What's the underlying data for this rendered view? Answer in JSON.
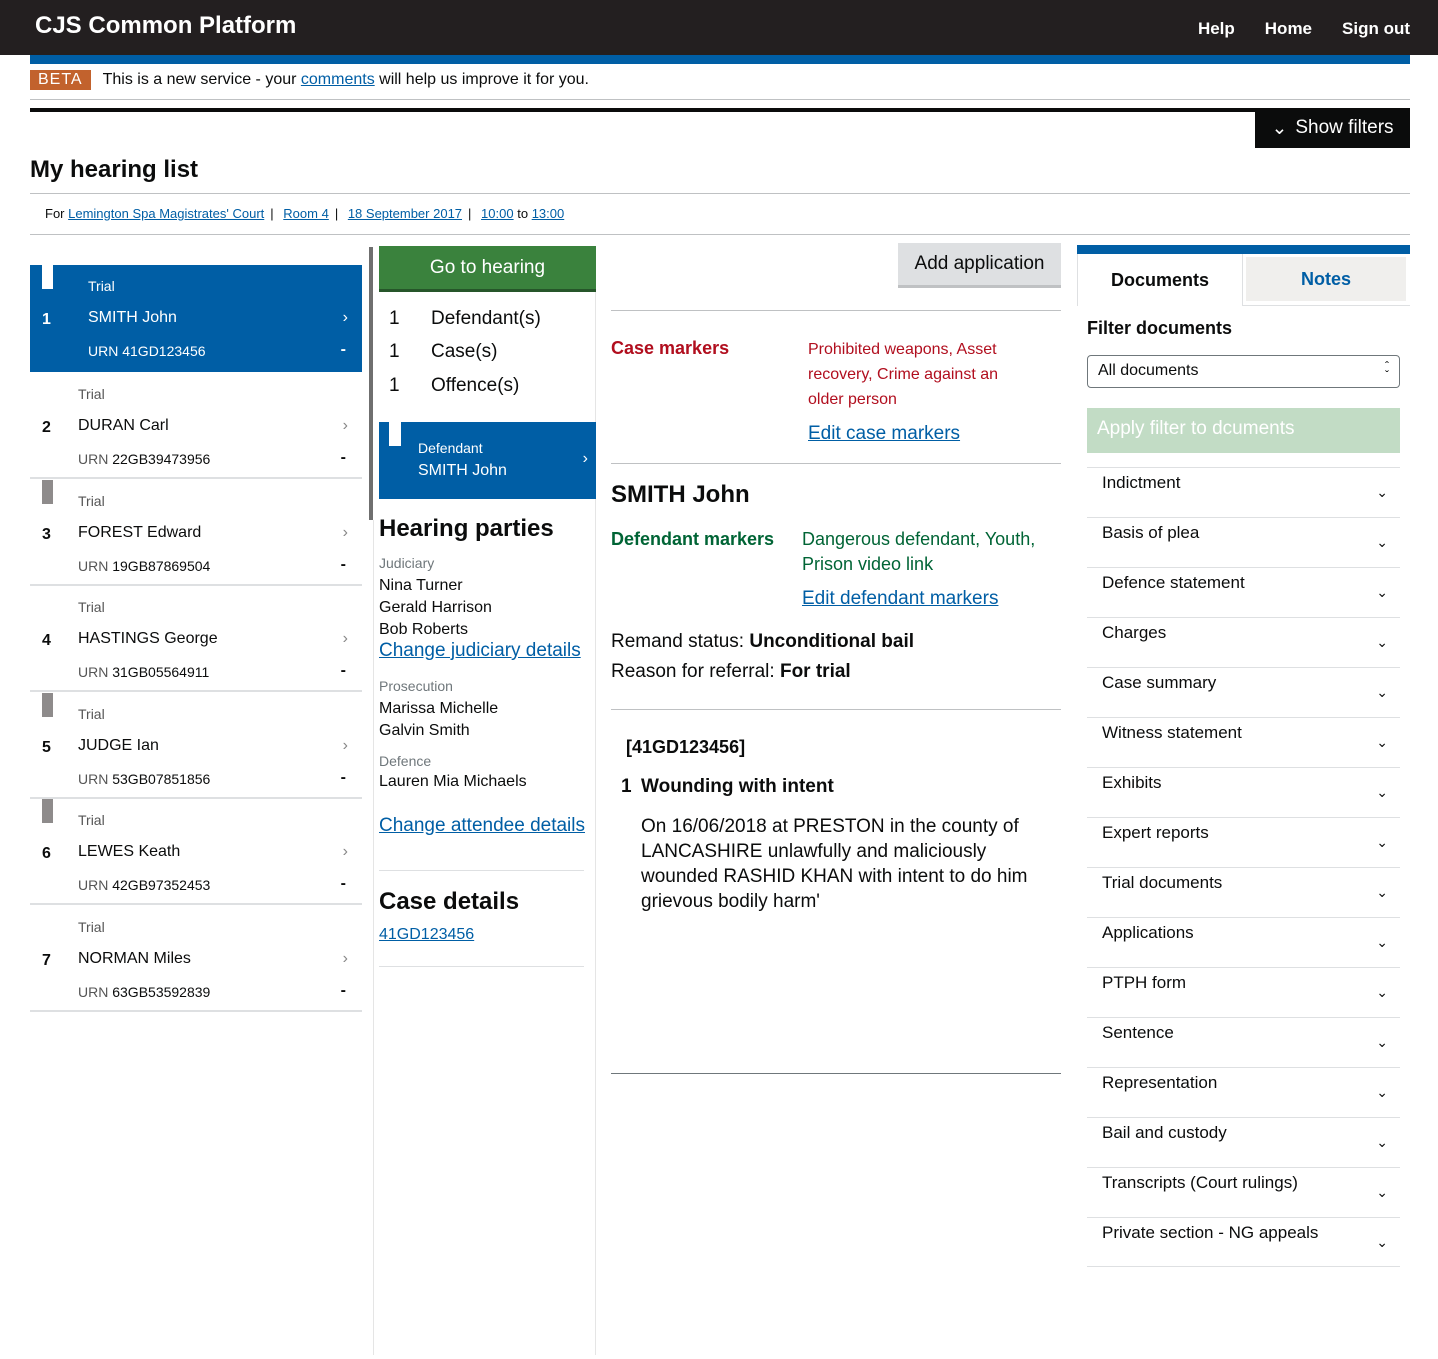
{
  "header": {
    "brand": "CJS Common Platform",
    "nav": [
      "Help",
      "Home",
      "Sign out"
    ]
  },
  "beta": {
    "tag": "BETA",
    "pre": "This is a new service - your ",
    "link": "comments",
    "post": " will help us improve it for you."
  },
  "show_filters": "Show filters",
  "page_title": "My hearing list",
  "breadcrumb": {
    "for": "For",
    "court": "Lemington Spa Magistrates' Court",
    "room": "Room 4",
    "date": "18 September 2017",
    "from": "10:00",
    "to_word": "to",
    "to": "13:00"
  },
  "hearings": [
    {
      "num": "1",
      "type": "Trial",
      "name": "SMITH John",
      "urn": "41GD123456"
    },
    {
      "num": "2",
      "type": "Trial",
      "name": "DURAN Carl",
      "urn": "22GB39473956"
    },
    {
      "num": "3",
      "type": "Trial",
      "name": "FOREST Edward",
      "urn": "19GB87869504"
    },
    {
      "num": "4",
      "type": "Trial",
      "name": "HASTINGS George",
      "urn": "31GB05564911"
    },
    {
      "num": "5",
      "type": "Trial",
      "name": "JUDGE Ian",
      "urn": "53GB07851856"
    },
    {
      "num": "6",
      "type": "Trial",
      "name": "LEWES Keath",
      "urn": "42GB97352453"
    },
    {
      "num": "7",
      "type": "Trial",
      "name": "NORMAN Miles",
      "urn": "63GB53592839"
    }
  ],
  "urn_label": "URN",
  "dash": "-",
  "middle": {
    "go_to_hearing": "Go to hearing",
    "counts": [
      {
        "n": "1",
        "label": "Defendant(s)"
      },
      {
        "n": "1",
        "label": "Case(s)"
      },
      {
        "n": "1",
        "label": "Offence(s)"
      }
    ],
    "defendant_label": "Defendant",
    "defendant_name": "SMITH John",
    "hearing_parties": "Hearing parties",
    "judiciary_label": "Judiciary",
    "judiciary": [
      "Nina Turner",
      "Gerald Harrison",
      "Bob Roberts"
    ],
    "change_judiciary": "Change judiciary details",
    "prosecution_label": "Prosecution",
    "prosecution": [
      "Marissa Michelle",
      "Galvin Smith"
    ],
    "defence_label": "Defence",
    "defence": [
      "Lauren Mia Michaels"
    ],
    "change_attendee": "Change attendee details",
    "case_details": "Case details",
    "case_link": "41GD123456"
  },
  "main": {
    "add_application": "Add application",
    "case_markers_label": "Case markers",
    "case_markers": [
      "Prohibited weapons, Asset",
      "recovery, Crime against an",
      "older person"
    ],
    "edit_case_markers": "Edit case markers",
    "defendant_name": "SMITH John",
    "defendant_markers_label": "Defendant markers",
    "defendant_markers": [
      "Dangerous defendant, Youth,",
      "Prison video link"
    ],
    "edit_defendant_markers": "Edit defendant markers",
    "remand_label": "Remand status: ",
    "remand": "Unconditional bail",
    "referral_label": "Reason for referral: ",
    "referral": "For trial",
    "case_ref": "[41GD123456]",
    "offence_num": "1",
    "offence_title": "Wounding with intent",
    "offence_text": [
      "On 16/06/2018 at PRESTON in the county of",
      "LANCASHIRE unlawfully and maliciously",
      "wounded RASHID KHAN with intent to do him",
      "grievous bodily harm'"
    ]
  },
  "right": {
    "tabs": [
      "Documents",
      "Notes"
    ],
    "filter_title": "Filter documents",
    "select_value": "All documents",
    "apply": "Apply filter to dcuments",
    "documents": [
      "Indictment",
      "Basis of plea",
      "Defence statement",
      "Charges",
      "Case summary",
      "Witness statement",
      "Exhibits",
      "Expert reports",
      "Trial documents",
      "Applications",
      "PTPH form",
      "Sentence",
      "Representation",
      "Bail and custody",
      "Transcripts (Court rulings)",
      "Private section - NG appeals"
    ]
  }
}
